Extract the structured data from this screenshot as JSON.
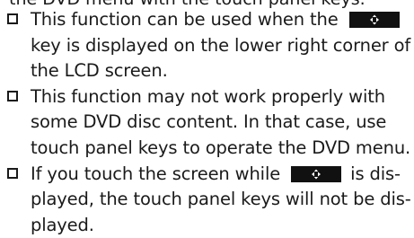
{
  "cut_line": "the DVD menu with the touch panel keys.",
  "notes": [
    {
      "lines": [
        [
          "This function can be used when the ",
          "KEY",
          ""
        ],
        [
          "key is displayed on the lower right corner of"
        ],
        [
          "the LCD screen."
        ]
      ]
    },
    {
      "lines": [
        [
          "This function may not work properly with"
        ],
        [
          "some DVD disc content. In that case, use"
        ],
        [
          "touch panel keys to operate the DVD menu."
        ]
      ]
    },
    {
      "lines": [
        [
          "If you touch the screen while ",
          "KEY",
          " is dis-"
        ],
        [
          "played, the touch panel keys will not be dis-"
        ],
        [
          "played."
        ]
      ]
    }
  ],
  "icons": {
    "checkbox": "checkbox-square-icon",
    "key": "arrow-key-icon"
  },
  "colors": {
    "text": "#1a1a1a",
    "key_background": "#111111",
    "key_arrows": "#ffffff"
  }
}
